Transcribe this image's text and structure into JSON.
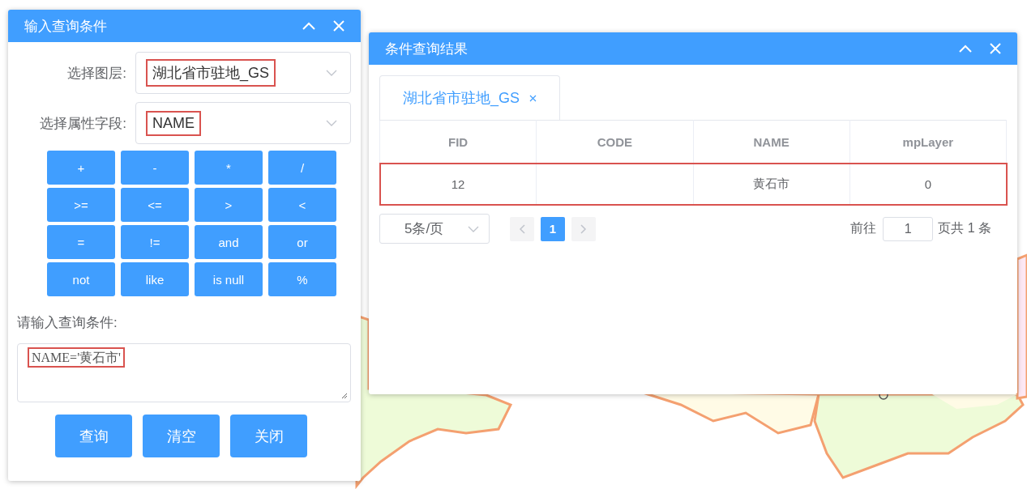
{
  "query_panel": {
    "title": "输入查询条件",
    "layer_label": "选择图层:",
    "layer_value": "湖北省市驻地_GS",
    "layer_highlighted": true,
    "field_label": "选择属性字段:",
    "field_value": "NAME",
    "field_highlighted": true,
    "operators": [
      "+",
      "-",
      "*",
      "/",
      ">=",
      "<=",
      ">",
      "<",
      "=",
      "!=",
      "and",
      "or",
      "not",
      "like",
      "is null",
      "%"
    ],
    "condition_label": "请输入查询条件:",
    "condition_value": "NAME='黄石市'",
    "condition_highlighted": true,
    "buttons": [
      "查询",
      "清空",
      "关闭"
    ]
  },
  "result_panel": {
    "title": "条件查询结果",
    "tabs": [
      {
        "label": "湖北省市驻地_GS",
        "selected": true
      }
    ],
    "table": {
      "columns": [
        "FID",
        "CODE",
        "NAME",
        "mpLayer"
      ],
      "rows": [
        {
          "cells": [
            "12",
            null,
            "黄石市",
            "0"
          ],
          "highlighted": true
        }
      ]
    },
    "pagination": {
      "page_size": "5条/页",
      "pages": [
        {
          "label": "1",
          "selected": true
        }
      ],
      "goto_label": "前往",
      "goto_value": "1",
      "total": "页共 1 条"
    }
  }
}
